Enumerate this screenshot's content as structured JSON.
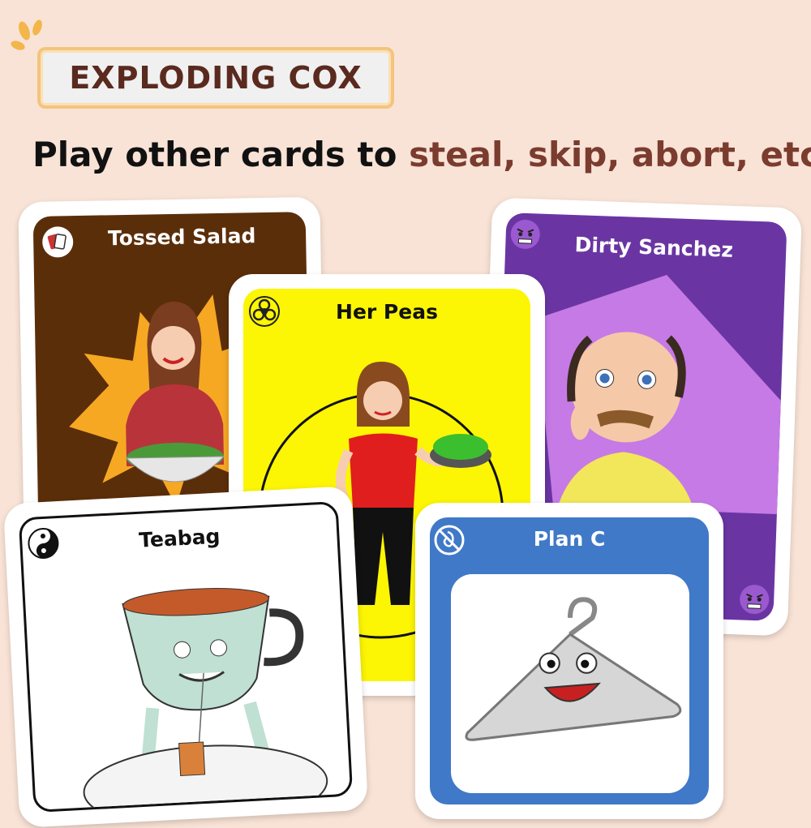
{
  "brand": {
    "title": "EXPLODING COX"
  },
  "headline": {
    "prefix": "Play other cards to ",
    "accent": "steal, skip, abort, etc."
  },
  "colors": {
    "background": "#f9e3d6",
    "accent": "#7a3c2f",
    "banner_border": "#f3c47c"
  },
  "cards": {
    "tossed_salad": {
      "title": "Tossed Salad",
      "icon": "cards-icon",
      "color": "#5b2e0a"
    },
    "dirty_sanchez": {
      "title": "Dirty Sanchez",
      "icon": "angry-face-icon",
      "color": "#6a35a3"
    },
    "her_peas": {
      "title": "Her Peas",
      "icon": "biohazard-icon",
      "color": "#fcf503"
    },
    "teabag": {
      "title": "Teabag",
      "icon": "yin-yang-icon",
      "color": "#ffffff"
    },
    "plan_c": {
      "title": "Plan C",
      "icon": "no-fetus-icon",
      "color": "#3f79c8"
    }
  }
}
